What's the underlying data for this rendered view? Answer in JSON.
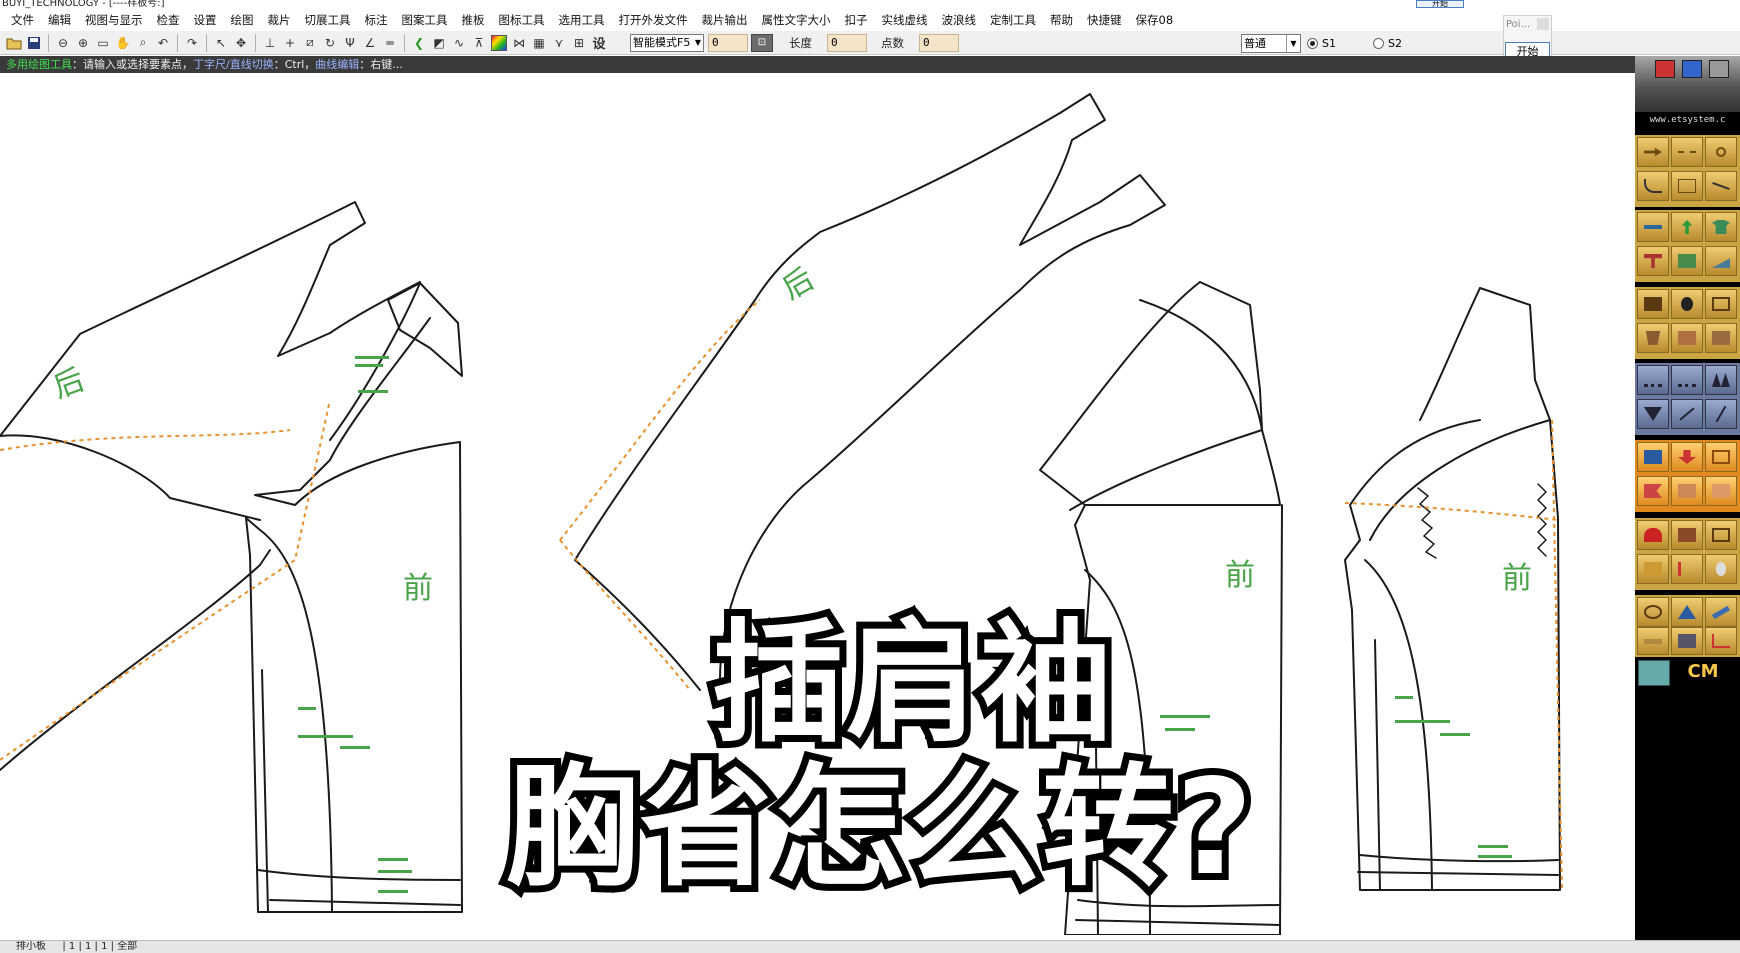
{
  "window": {
    "title": "BUYI_TECHNOLOGY - [----样板号:]"
  },
  "menu": [
    "文件",
    "编辑",
    "视图与显示",
    "检查",
    "设置",
    "绘图",
    "裁片",
    "切展工具",
    "标注",
    "图案工具",
    "推板",
    "图标工具",
    "选用工具",
    "打开外发文件",
    "裁片输出",
    "属性文字大小",
    "扣子",
    "实线虚线",
    "波浪线",
    "定制工具",
    "帮助",
    "快捷键",
    "保存08"
  ],
  "top_button": "开始",
  "toolbar": {
    "set_label": "设",
    "mode_select": "智能模式F5",
    "input_1": "0",
    "length_label": "长度",
    "length_value": "0",
    "points_label": "点数",
    "points_value": "0",
    "grade_select": "普通",
    "radio_s1": "S1",
    "radio_s2": "S2"
  },
  "popup": {
    "title": "Poi...",
    "start": "开始"
  },
  "status": {
    "tool": "多用绘图工具",
    "hint": "：请输入或选择要素点，",
    "switch": "丁字尺/直线切换",
    "ctrl": "：Ctrl，",
    "curve": "曲线编辑",
    "right": "：右键..."
  },
  "right_panel": {
    "site": "www.etsystem.c",
    "cm": "CM"
  },
  "pieces": {
    "back_1": "后",
    "front_1": "前",
    "back_2": "后",
    "front_2": "前",
    "front_3": "前"
  },
  "bottom": "排小板 　 | 1 | 1 | 1 | 全部",
  "caption": {
    "line1": "插肩袖",
    "line2": "胸省怎么转?"
  },
  "colors": {
    "piece_label": "#49a449",
    "seam_dash": "#e8922e",
    "panel_gold": "#c9a544",
    "status_bg": "#3a3a3a"
  },
  "icons": [
    "open-folder-icon",
    "save-icon",
    "zoom-out-icon",
    "zoom-in-icon",
    "fit-window-icon",
    "pan-hand-icon",
    "zoom-area-icon",
    "undo-icon",
    "redo-icon",
    "select-cursor-icon",
    "move-cross-icon",
    "lock-icon"
  ]
}
